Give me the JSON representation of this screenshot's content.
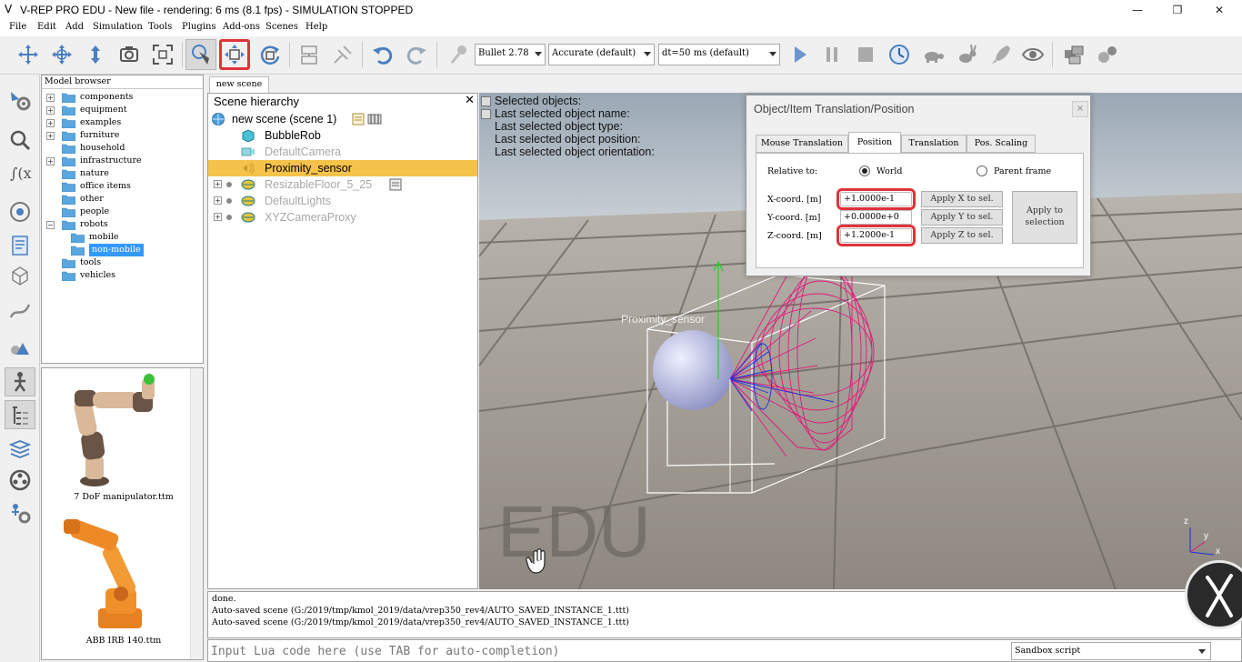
{
  "window": {
    "title": "V-REP PRO EDU - New file - rendering: 6 ms (8.1 fps) - SIMULATION STOPPED",
    "controls": {
      "minimize": "—",
      "restore": "❐",
      "close": "✕"
    }
  },
  "menu": [
    "File",
    "Edit",
    "Add",
    "Simulation",
    "Tools",
    "Plugins",
    "Add-ons",
    "Scenes",
    "Help"
  ],
  "toolbar": {
    "engine": "Bullet 2.78",
    "accuracy": "Accurate (default)",
    "timestep": "dt=50 ms (default)"
  },
  "model_browser": {
    "title": "Model browser",
    "items": [
      {
        "label": "components",
        "expandable": true
      },
      {
        "label": "equipment",
        "expandable": true
      },
      {
        "label": "examples",
        "expandable": true
      },
      {
        "label": "furniture",
        "expandable": true
      },
      {
        "label": "household",
        "expandable": false
      },
      {
        "label": "infrastructure",
        "expandable": true
      },
      {
        "label": "nature",
        "expandable": false
      },
      {
        "label": "office items",
        "expandable": false
      },
      {
        "label": "other",
        "expandable": false
      },
      {
        "label": "people",
        "expandable": false
      },
      {
        "label": "robots",
        "expandable": true
      },
      {
        "label": "mobile",
        "expandable": false
      },
      {
        "label": "non-mobile",
        "expandable": false
      },
      {
        "label": "tools",
        "expandable": false
      },
      {
        "label": "vehicles",
        "expandable": false
      }
    ],
    "thumbnails": [
      "7 DoF manipulator.ttm",
      "ABB IRB 140.ttm"
    ]
  },
  "scene": {
    "tab": "new scene",
    "hierarchy_title": "Scene hierarchy",
    "close": "✕",
    "root": "new scene (scene 1)",
    "objects": [
      {
        "label": "BubbleRob",
        "dim": false,
        "selected": false
      },
      {
        "label": "DefaultCamera",
        "dim": true,
        "selected": false
      },
      {
        "label": "Proximity_sensor",
        "dim": false,
        "selected": true
      },
      {
        "label": "ResizableFloor_5_25",
        "dim": true,
        "selected": false
      },
      {
        "label": "DefaultLights",
        "dim": true,
        "selected": false
      },
      {
        "label": "XYZCameraProxy",
        "dim": true,
        "selected": false
      }
    ]
  },
  "viewport": {
    "info": [
      "Selected objects:",
      "Last selected object name:",
      "Last selected object type:",
      "Last selected object position:",
      "Last selected object orientation:"
    ],
    "sensor_label": "Proximity_sensor",
    "watermark": "EDU",
    "axes": {
      "z": "z",
      "y": "y",
      "x": "x"
    }
  },
  "dialog": {
    "title": "Object/Item Translation/Position",
    "close": "×",
    "tabs": [
      "Mouse Translation",
      "Position",
      "Translation",
      "Pos. Scaling"
    ],
    "active_tab": 1,
    "relative_to": "Relative to:",
    "world": "World",
    "parent_frame": "Parent frame",
    "x_label": "X-coord. [m]",
    "y_label": "Y-coord. [m]",
    "z_label": "Z-coord. [m]",
    "x_value": "+1.0000e-1",
    "y_value": "+0.0000e+0",
    "z_value": "+1.2000e-1",
    "apply_x": "Apply X to sel.",
    "apply_y": "Apply Y to sel.",
    "apply_z": "Apply Z to sel.",
    "apply_selection": "Apply to selection"
  },
  "console": {
    "lines": [
      "done.",
      "Auto-saved scene (G:/2019/tmp/kmol_2019/data/vrep350_rev4/AUTO_SAVED_INSTANCE_1.ttt)",
      "Auto-saved scene (G:/2019/tmp/kmol_2019/data/vrep350_rev4/AUTO_SAVED_INSTANCE_1.ttt)"
    ],
    "lua_placeholder": "Input Lua code here (use TAB for auto-completion)",
    "script_select": "Sandbox script"
  },
  "colors": {
    "accent_highlight": "#e0333a",
    "selection": "#f5c24c",
    "tree_selection": "#3399ff",
    "sensor": "#e0187a"
  }
}
